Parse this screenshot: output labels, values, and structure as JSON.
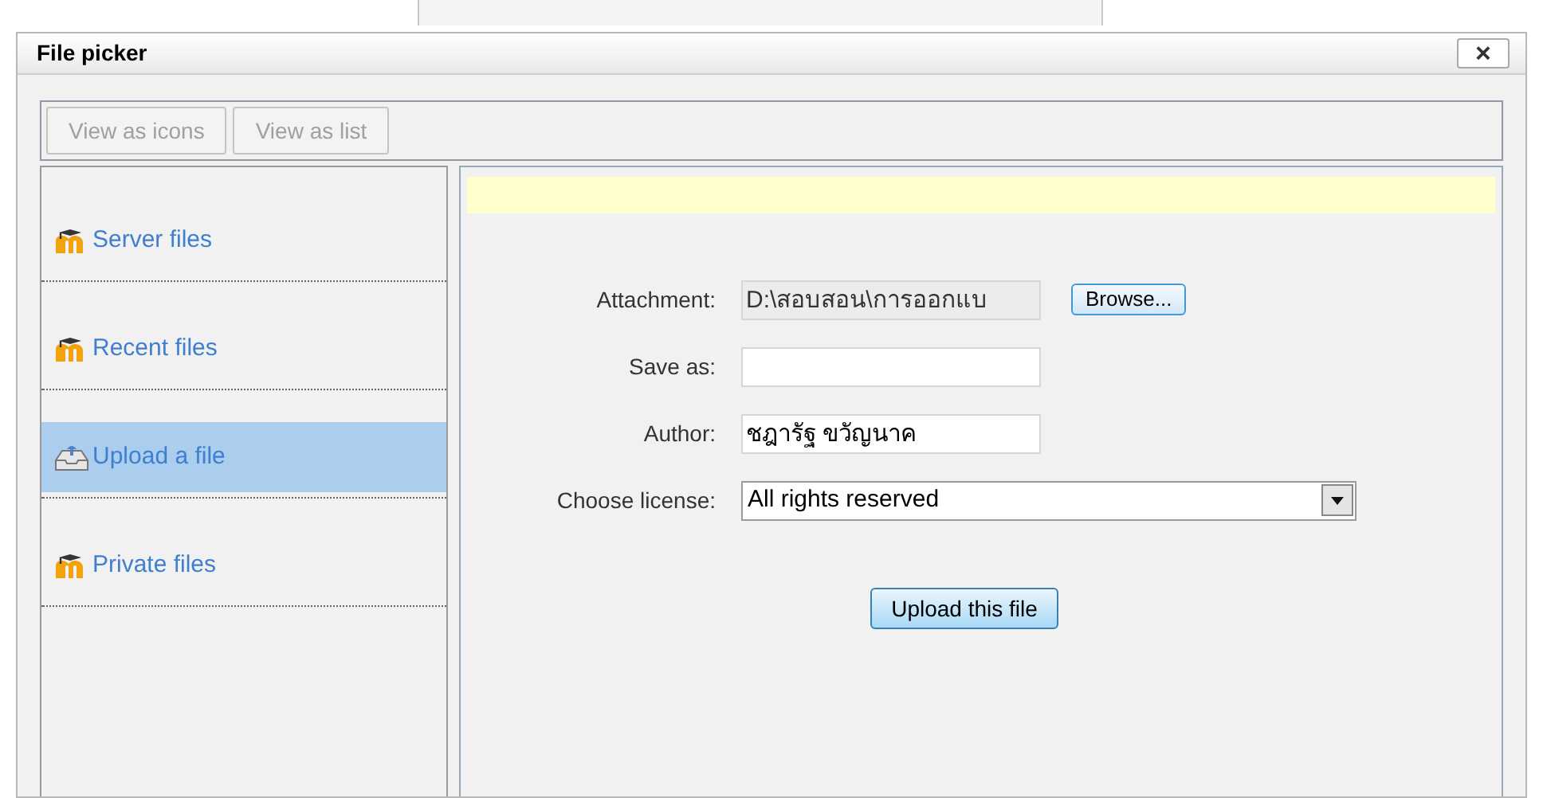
{
  "window": {
    "title": "File picker",
    "close": "×"
  },
  "view_buttons": [
    {
      "label": "View as icons",
      "disabled": true
    },
    {
      "label": "View as list",
      "disabled": true
    }
  ],
  "repositories": [
    {
      "label": "Server files",
      "kind": "moodle",
      "selected": false
    },
    {
      "label": "Recent files",
      "kind": "moodle",
      "selected": false
    },
    {
      "label": "Upload a file",
      "kind": "upload",
      "selected": true
    },
    {
      "label": "Private files",
      "kind": "moodle",
      "selected": false
    }
  ],
  "form": {
    "fields": [
      {
        "kind": "file",
        "label": "Attachment:",
        "value": "D:\\สอบสอน\\การออกแบ",
        "button": "Browse..."
      },
      {
        "kind": "text",
        "label": "Save as:"
      },
      {
        "kind": "text",
        "label": "Author:",
        "value": "ชฎารัฐ ขวัญนาค"
      },
      {
        "kind": "select",
        "label": "Choose license:",
        "value": "All rights reserved"
      }
    ],
    "submit": "Upload this file"
  }
}
